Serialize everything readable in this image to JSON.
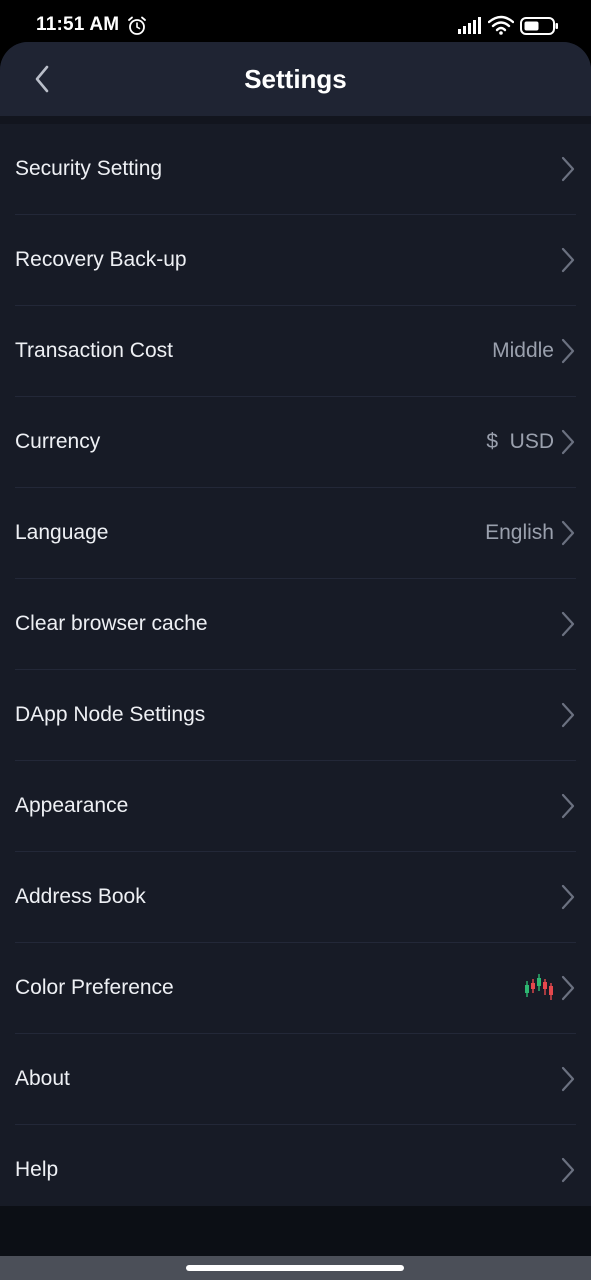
{
  "status_bar": {
    "time": "11:51 AM",
    "icons": [
      "alarm-icon",
      "signal-icon",
      "wifi-icon",
      "battery-icon"
    ]
  },
  "header": {
    "title": "Settings",
    "back_icon": "chevron-left-icon"
  },
  "settings": [
    {
      "label": "Security Setting",
      "value": ""
    },
    {
      "label": "Recovery Back-up",
      "value": ""
    },
    {
      "label": "Transaction Cost",
      "value": "Middle"
    },
    {
      "label": "Currency",
      "value": "$  USD"
    },
    {
      "label": "Language",
      "value": "English"
    },
    {
      "label": "Clear browser cache",
      "value": ""
    },
    {
      "label": "DApp Node Settings",
      "value": ""
    },
    {
      "label": "Appearance",
      "value": ""
    },
    {
      "label": "Address Book",
      "value": ""
    },
    {
      "label": "Color Preference",
      "value": "",
      "value_icon": "candlestick-icon"
    },
    {
      "label": "About",
      "value": ""
    },
    {
      "label": "Help",
      "value": ""
    }
  ],
  "colors": {
    "background": "#171b26",
    "header": "#1f2433",
    "text": "#eef0f4",
    "secondary_text": "#9aa0ad",
    "up_color": "#2eb872",
    "down_color": "#e5484d"
  }
}
